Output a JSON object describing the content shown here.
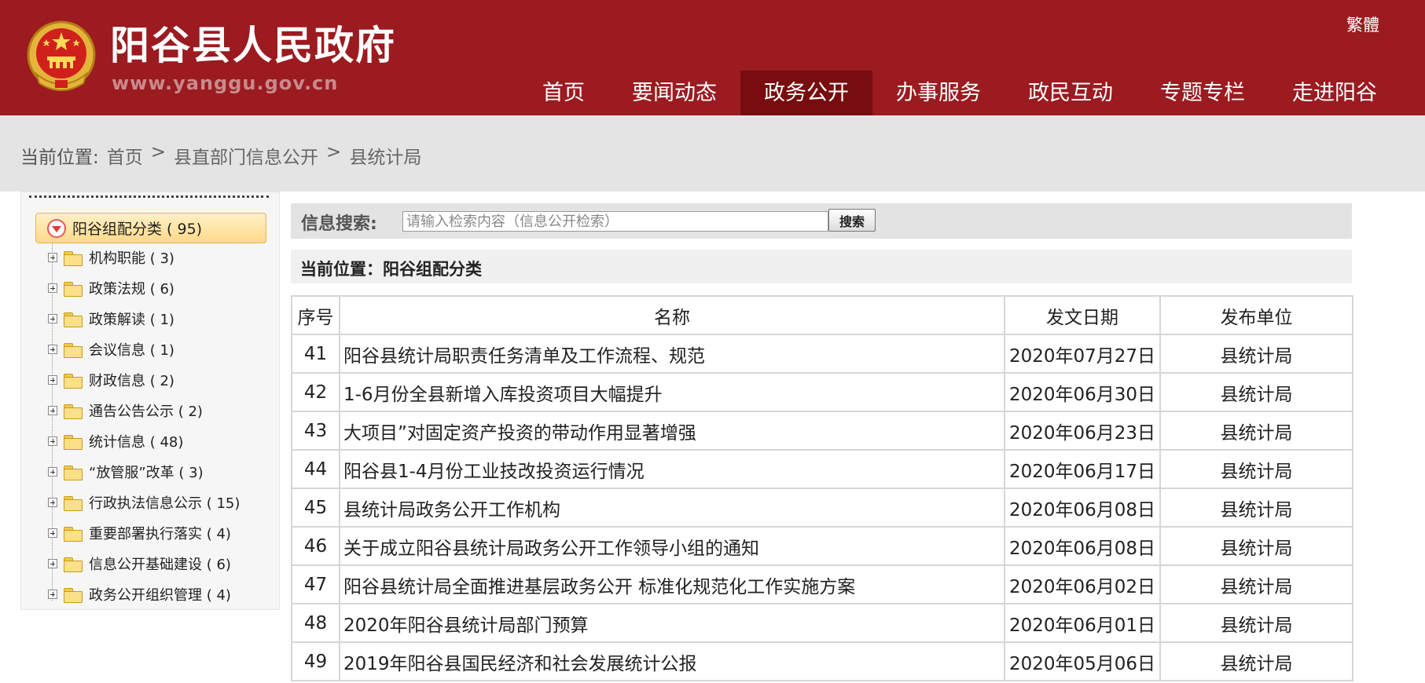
{
  "header": {
    "title": "阳谷县人民政府",
    "url": "www.yanggu.gov.cn",
    "traditional_link": "繁體",
    "brand_color": "#9b1b20",
    "nav": [
      {
        "label": "首页",
        "active": false
      },
      {
        "label": "要闻动态",
        "active": false
      },
      {
        "label": "政务公开",
        "active": true
      },
      {
        "label": "办事服务",
        "active": false
      },
      {
        "label": "政民互动",
        "active": false
      },
      {
        "label": "专题专栏",
        "active": false
      },
      {
        "label": "走进阳谷",
        "active": false
      }
    ]
  },
  "breadcrumb": {
    "label": "当前位置:",
    "items": [
      "首页",
      "县直部门信息公开",
      "县统计局"
    ],
    "separator": ">"
  },
  "sidebar": {
    "root": "阳谷组配分类 ( 95)",
    "items": [
      "机构职能 ( 3)",
      "政策法规 ( 6)",
      "政策解读 ( 1)",
      "会议信息 ( 1)",
      "财政信息 ( 2)",
      "通告公告公示 ( 2)",
      "统计信息 ( 48)",
      "“放管服”改革 ( 3)",
      "行政执法信息公示 ( 15)",
      "重要部署执行落实 ( 4)",
      "信息公开基础建设 ( 6)",
      "政务公开组织管理 ( 4)"
    ]
  },
  "search": {
    "label": "信息搜索:",
    "placeholder": "请输入检索内容（信息公开检索）",
    "button": "搜索"
  },
  "position": {
    "text": "当前位置：阳谷组配分类"
  },
  "table": {
    "headers": [
      "序号",
      "名称",
      "发文日期",
      "发布单位"
    ],
    "rows": [
      {
        "no": "41",
        "name": "阳谷县统计局职责任务清单及工作流程、规范",
        "date": "2020年07月27日",
        "unit": "县统计局"
      },
      {
        "no": "42",
        "name": "1-6月份全县新增入库投资项目大幅提升",
        "date": "2020年06月30日",
        "unit": "县统计局"
      },
      {
        "no": "43",
        "name": "大项目”对固定资产投资的带动作用显著增强",
        "date": "2020年06月23日",
        "unit": "县统计局"
      },
      {
        "no": "44",
        "name": "阳谷县1-4月份工业技改投资运行情况",
        "date": "2020年06月17日",
        "unit": "县统计局"
      },
      {
        "no": "45",
        "name": "县统计局政务公开工作机构",
        "date": "2020年06月08日",
        "unit": "县统计局"
      },
      {
        "no": "46",
        "name": "关于成立阳谷县统计局政务公开工作领导小组的通知",
        "date": "2020年06月08日",
        "unit": "县统计局"
      },
      {
        "no": "47",
        "name": "阳谷县统计局全面推进基层政务公开 标准化规范化工作实施方案",
        "date": "2020年06月02日",
        "unit": "县统计局"
      },
      {
        "no": "48",
        "name": "2020年阳谷县统计局部门预算",
        "date": "2020年06月01日",
        "unit": "县统计局"
      },
      {
        "no": "49",
        "name": "2019年阳谷县国民经济和社会发展统计公报",
        "date": "2020年05月06日",
        "unit": "县统计局"
      }
    ]
  }
}
